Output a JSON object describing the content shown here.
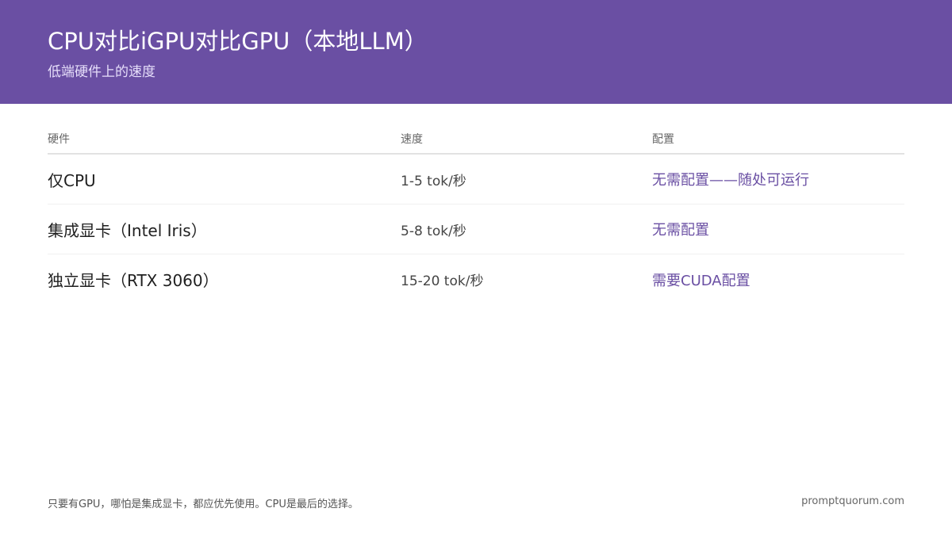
{
  "header": {
    "title": "CPU对比iGPU对比GPU（本地LLM）",
    "subtitle": "低端硬件上的速度"
  },
  "table": {
    "columns": [
      "硬件",
      "速度",
      "配置"
    ],
    "rows": [
      {
        "hardware": "仅CPU",
        "speed": "1-5 tok/秒",
        "config": "无需配置——随处可运行"
      },
      {
        "hardware": "集成显卡（Intel Iris）",
        "speed": "5-8 tok/秒",
        "config": "无需配置"
      },
      {
        "hardware": "独立显卡（RTX 3060）",
        "speed": "15-20 tok/秒",
        "config": "需要CUDA配置"
      }
    ]
  },
  "footer": {
    "note": "只要有GPU，哪怕是集成显卡，都应优先使用。CPU是最后的选择。",
    "site": "promptquorum.com"
  },
  "colors": {
    "accent": "#6a4fa3",
    "header_bg": "#6a4fa3"
  }
}
